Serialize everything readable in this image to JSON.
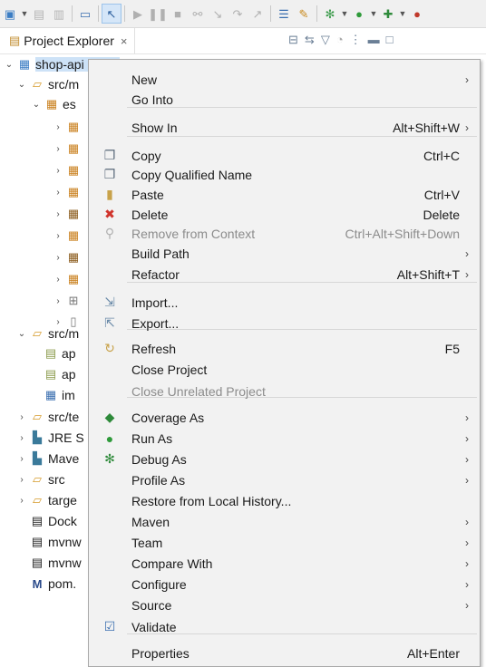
{
  "toolbar": {
    "icons": [
      "new-wizard-icon",
      "dropdown-icon",
      "save-icon",
      "save-all-icon",
      "console-icon",
      "select-icon",
      "resume-icon",
      "suspend-icon",
      "terminate-icon",
      "disconnect-icon",
      "step-into-icon",
      "step-over-icon",
      "step-return-icon",
      "toggle-mark-icon",
      "open-task-icon",
      "coverage-icon",
      "run-icon",
      "debug-icon"
    ]
  },
  "panel": {
    "title": "Project Explorer",
    "close": "×"
  },
  "tree": {
    "root": "shop-api (in ...)",
    "src_main_java": "src/m",
    "package": "es",
    "src_main_resources": "src/m",
    "res_app1": "ap",
    "res_app2": "ap",
    "res_im": "im",
    "src_test": "src/te",
    "jre": "JRE S",
    "maven_deps": "Mave",
    "src": "src",
    "target": "targe",
    "dockerfile": "Dock",
    "mvnw": "mvnw",
    "mvnw_cmd": "mvnw",
    "pom": "pom."
  },
  "menu": {
    "items": [
      {
        "label": "New",
        "accel": "",
        "submenu": true,
        "disabled": false,
        "icon": ""
      },
      {
        "label": "Go Into",
        "accel": "",
        "submenu": false,
        "disabled": false,
        "icon": ""
      },
      {
        "label": "Show In",
        "accel": "Alt+Shift+W",
        "submenu": true,
        "disabled": false,
        "icon": ""
      },
      {
        "label": "Copy",
        "accel": "Ctrl+C",
        "submenu": false,
        "disabled": false,
        "icon": "copy-icon"
      },
      {
        "label": "Copy Qualified Name",
        "accel": "",
        "submenu": false,
        "disabled": false,
        "icon": "copy-qualified-name-icon"
      },
      {
        "label": "Paste",
        "accel": "Ctrl+V",
        "submenu": false,
        "disabled": false,
        "icon": "paste-icon"
      },
      {
        "label": "Delete",
        "accel": "Delete",
        "submenu": false,
        "disabled": false,
        "icon": "delete-icon"
      },
      {
        "label": "Remove from Context",
        "accel": "Ctrl+Alt+Shift+Down",
        "submenu": false,
        "disabled": true,
        "icon": "remove-from-context-icon"
      },
      {
        "label": "Build Path",
        "accel": "",
        "submenu": true,
        "disabled": false,
        "icon": ""
      },
      {
        "label": "Refactor",
        "accel": "Alt+Shift+T",
        "submenu": true,
        "disabled": false,
        "icon": ""
      },
      {
        "label": "Import...",
        "accel": "",
        "submenu": false,
        "disabled": false,
        "icon": "import-icon"
      },
      {
        "label": "Export...",
        "accel": "",
        "submenu": false,
        "disabled": false,
        "icon": "export-icon"
      },
      {
        "label": "Refresh",
        "accel": "F5",
        "submenu": false,
        "disabled": false,
        "icon": "refresh-icon"
      },
      {
        "label": "Close Project",
        "accel": "",
        "submenu": false,
        "disabled": false,
        "icon": ""
      },
      {
        "label": "Close Unrelated Project",
        "accel": "",
        "submenu": false,
        "disabled": true,
        "icon": ""
      },
      {
        "label": "Coverage As",
        "accel": "",
        "submenu": true,
        "disabled": false,
        "icon": "coverage-icon"
      },
      {
        "label": "Run As",
        "accel": "",
        "submenu": true,
        "disabled": false,
        "icon": "run-icon"
      },
      {
        "label": "Debug As",
        "accel": "",
        "submenu": true,
        "disabled": false,
        "icon": "debug-icon"
      },
      {
        "label": "Profile As",
        "accel": "",
        "submenu": true,
        "disabled": false,
        "icon": ""
      },
      {
        "label": "Restore from Local History...",
        "accel": "",
        "submenu": false,
        "disabled": false,
        "icon": ""
      },
      {
        "label": "Maven",
        "accel": "",
        "submenu": true,
        "disabled": false,
        "icon": ""
      },
      {
        "label": "Team",
        "accel": "",
        "submenu": true,
        "disabled": false,
        "icon": ""
      },
      {
        "label": "Compare With",
        "accel": "",
        "submenu": true,
        "disabled": false,
        "icon": ""
      },
      {
        "label": "Configure",
        "accel": "",
        "submenu": true,
        "disabled": false,
        "icon": ""
      },
      {
        "label": "Source",
        "accel": "",
        "submenu": true,
        "disabled": false,
        "icon": ""
      },
      {
        "label": "Validate",
        "accel": "",
        "submenu": false,
        "disabled": false,
        "icon": "validate-check-icon"
      },
      {
        "label": "Properties",
        "accel": "Alt+Enter",
        "submenu": false,
        "disabled": false,
        "icon": ""
      }
    ]
  }
}
